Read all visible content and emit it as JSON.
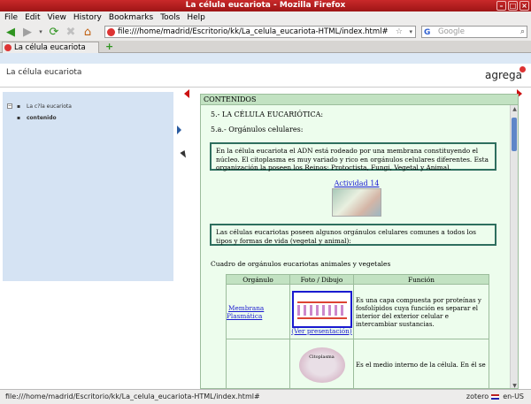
{
  "window": {
    "title": "La célula eucariota - Mozilla Firefox"
  },
  "menu": [
    "File",
    "Edit",
    "View",
    "History",
    "Bookmarks",
    "Tools",
    "Help"
  ],
  "navbar": {
    "url": "file:///home/madrid/Escritorio/kk/La_celula_eucariota-HTML/index.html#",
    "search_placeholder": "Google"
  },
  "tab": {
    "label": "La célula eucariota"
  },
  "page": {
    "header_title": "La célula eucariota",
    "logo": "agrega",
    "tree_root": "La c?la eucariota",
    "tree_child": "contenido"
  },
  "content": {
    "frame_title": "CONTENIDOS",
    "heading": "5.- LA CÉLULA EUCARIÓTICA:",
    "subheading": "5.a.- Orgánulos celulares:",
    "box1": "En la célula eucariota el ADN está rodeado por una membrana constituyendo el núcleo. El citoplasma es muy variado y rico en orgánulos celulares diferentes. Esta organización la poseen los Reinos: Protoctista, Fungi, Vegetal y Animal.",
    "activity_link": "Actividad 14",
    "box2": "Las células eucariotas poseen algunos orgánulos celulares comunes a todos los tipos y formas de vida (vegetal y animal):",
    "table_caption": "Cuadro de orgánulos eucariotas animales y vegetales",
    "table_headers": [
      "Orgánulo",
      "Foto / Dibujo",
      "Función"
    ],
    "rows": [
      {
        "organo": "Membrana Plasmática",
        "ver": "(Ver presentación)",
        "funcion": "Es una capa compuesta por proteínas y fosfolípidos cuya función es separar el interior del exterior celular e intercambiar sustancias."
      },
      {
        "organo": "",
        "img_label": "Citoplasma",
        "funcion": "Es el medio interno de la célula. En él se"
      }
    ]
  },
  "status": {
    "text": "file:///home/madrid/Escritorio/kk/La_celula_eucariota-HTML/index.html#",
    "right": "zotero",
    "locale": "en-US"
  },
  "colors": {
    "titlebar": "#c9292a",
    "frame_bg": "#edfded",
    "box_border": "#2e6e5e",
    "sidebar": "#d5e3f3"
  }
}
